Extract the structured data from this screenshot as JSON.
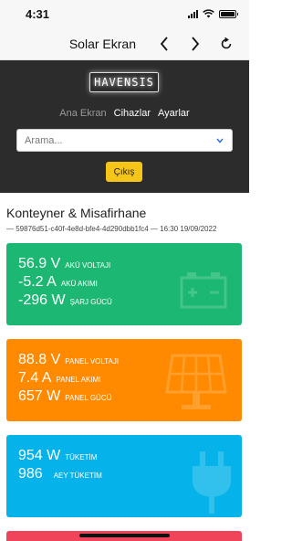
{
  "status": {
    "time": "4:31"
  },
  "nav": {
    "title": "Solar Ekran"
  },
  "brand": {
    "logo_text": "HAVENSIS"
  },
  "menu": {
    "items": [
      "Ana Ekran",
      "Cihazlar",
      "Ayarlar"
    ]
  },
  "search": {
    "placeholder": "Arama..."
  },
  "logout": {
    "label": "Çıkış"
  },
  "device": {
    "name": "Konteyner & Misafirhane",
    "meta": "— 59876d51-c40f-4e8d-bfe4-4d290dbb1fc4 — 16:30 19/09/2022"
  },
  "cards": {
    "battery": {
      "color": "#1cb873",
      "icon": "battery-icon",
      "rows": [
        {
          "value": "56.9 V",
          "label": "AKÜ VOLTAJI"
        },
        {
          "value": "-5.2 A",
          "label": "AKÜ AKIMI"
        },
        {
          "value": "-296 W",
          "label": "ŞARJ GÜCÜ"
        }
      ]
    },
    "panel": {
      "color": "#ff8a00",
      "icon": "solar-panel-icon",
      "rows": [
        {
          "value": "88.8 V",
          "label": "PANEL VOLTAJI"
        },
        {
          "value": "7.4 A",
          "label": "PANEL AKIMI"
        },
        {
          "value": "657 W",
          "label": "PANEL GÜCÜ"
        }
      ]
    },
    "consumption": {
      "color": "#05b3ea",
      "icon": "plug-icon",
      "rows": [
        {
          "value": "954 W",
          "label": "TÜKETİM"
        },
        {
          "value": "986",
          "label": "AEY TÜKETİM"
        }
      ]
    },
    "extra": {
      "color": "#f0445a"
    }
  }
}
